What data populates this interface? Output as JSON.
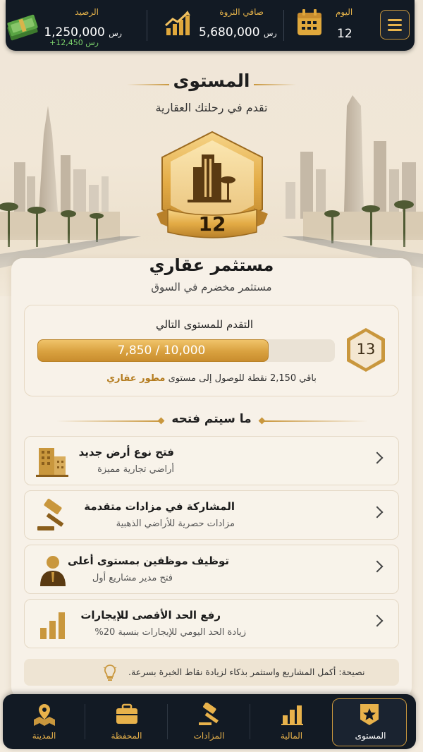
{
  "topbar": {
    "balance_label": "الرصيد",
    "balance_value": "1,250,000",
    "balance_currency": "رس",
    "balance_delta": "+12,450 رس",
    "networth_label": "صافي الثروة",
    "networth_value": "5,680,000",
    "networth_currency": "رس",
    "day_label": "اليوم",
    "day_value": "12"
  },
  "header": {
    "title": "المستوى",
    "subtitle": "تقدم في رحلتك العقارية"
  },
  "badge": {
    "level": "12"
  },
  "rank": {
    "title": "مستثمر عقاري",
    "subtitle": "مستثمر مخضرم في السوق"
  },
  "progress": {
    "label": "التقدم للمستوى التالي",
    "text": "7,850 / 10,000",
    "current": 7850,
    "max": 10000,
    "next_level": "13",
    "remain_prefix": "باقي 2,150 نقطة للوصول إلى مستوى",
    "remain_target": "مطور عقاري"
  },
  "unlocks": {
    "heading": "ما سيتم فتحه",
    "items": [
      {
        "title": "فتح نوع أرض جديد",
        "subtitle": "أراضي تجارية مميزة",
        "icon": "buildings-icon"
      },
      {
        "title": "المشاركة في مزادات متقدمة",
        "subtitle": "مزادات حصرية للأراضي الذهبية",
        "icon": "gavel-icon"
      },
      {
        "title": "توظيف موظفين بمستوى أعلى",
        "subtitle": "فتح مدير مشاريع أول",
        "icon": "manager-icon"
      },
      {
        "title": "رفع الحد الأقصى للإيجارات",
        "subtitle": "زيادة الحد اليومي للإيجارات بنسبة 20%",
        "icon": "bar-chart-icon"
      }
    ]
  },
  "tip": {
    "text": "نصيحة: أكمل المشاريع واستثمر بذكاء لزيادة نقاط الخبرة بسرعة."
  },
  "nav": {
    "items": [
      {
        "label": "المدينة",
        "icon": "map-pin-icon"
      },
      {
        "label": "المحفظة",
        "icon": "briefcase-icon"
      },
      {
        "label": "المزادات",
        "icon": "gavel-icon"
      },
      {
        "label": "المالية",
        "icon": "bar-chart-icon"
      },
      {
        "label": "المستوى",
        "icon": "star-badge-icon",
        "active": true
      }
    ]
  },
  "colors": {
    "gold": "#c9973d",
    "dark": "#121a24",
    "accent_text": "#b47c1f"
  }
}
